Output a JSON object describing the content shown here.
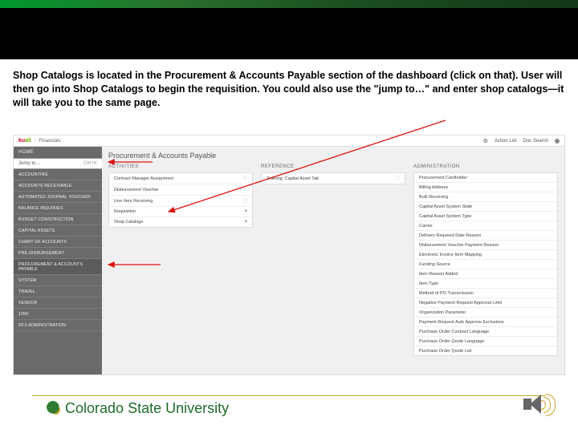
{
  "instructions": "Shop Catalogs is located in the Procurement & Accounts Payable section of the dashboard (click on that). User will then go into Shop Catalogs to begin the requisition.  You could also use the \"jump to…\" and enter shop catalogs—it will take you to the same page.",
  "app": {
    "brand_logo": "kuali",
    "brand_product": "Financials",
    "header_actions": {
      "action_list": "Action List",
      "doc_search": "Doc Search"
    }
  },
  "sidebar": {
    "home": "HOME",
    "jump_placeholder": "Jump to…",
    "jump_hint": "Ctrl+K",
    "items": [
      "ACCOUNTING",
      "ACCOUNTS RECEIVABLE",
      "AUTOMATED JOURNAL VOUCHER",
      "BALANCE INQUIRIES",
      "BUDGET CONSTRUCTION",
      "CAPITAL ASSETS",
      "CHART OF ACCOUNTS",
      "PRE-DISBURSEMENT",
      "PROCUREMENT & ACCOUNTS PAYABLE",
      "SYSTEM",
      "TRAVEL",
      "VENDOR",
      "1099",
      "DFS ADMINISTRATION"
    ]
  },
  "content": {
    "title": "Procurement & Accounts Payable",
    "cols": {
      "activities": {
        "head": "ACTIVITIES",
        "rows": [
          "Contract Manager Assignment",
          "Disbursement Voucher",
          "Line Item Receiving",
          "Requisition",
          "Shop Catalogs"
        ]
      },
      "reference": {
        "head": "REFERENCE",
        "rows": [
          "Training: Capital Asset Tab"
        ]
      },
      "administration": {
        "head": "ADMINISTRATION",
        "rows": [
          "Procurement Cardholder",
          "Billing Address",
          "Bulk Receiving",
          "Capital Asset System State",
          "Capital Asset System Type",
          "Carrier",
          "Delivery Required Date Reason",
          "Disbursement Voucher Payment Reason",
          "Electronic Invoice Item Mapping",
          "Funding Source",
          "Item Reason Added",
          "Item Type",
          "Method of PO Transmission",
          "Negative Payment Request Approval Limit",
          "Organization Parameter",
          "Payment Request Auto Approve Exclusions",
          "Purchase Order Contract Language",
          "Purchase Order Quote Language",
          "Purchase Order Quote List"
        ]
      }
    }
  },
  "footer": {
    "university": "Colorado State University"
  }
}
